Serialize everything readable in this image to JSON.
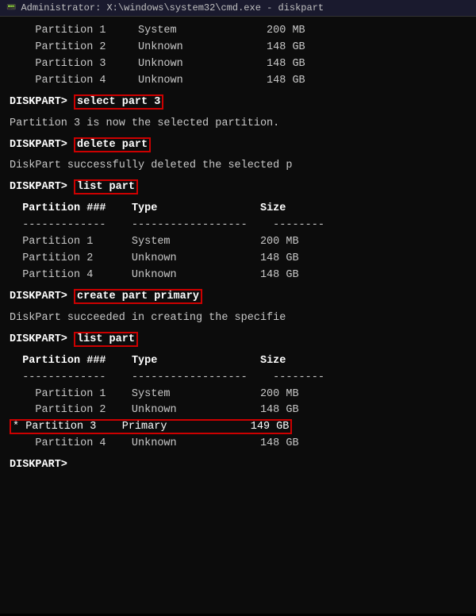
{
  "titleBar": {
    "icon": "C:\\",
    "title": "Administrator: X:\\windows\\system32\\cmd.exe - diskpart"
  },
  "terminal": {
    "initialPartitions": [
      {
        "name": "Partition 1",
        "type": "System",
        "size": "200 MB"
      },
      {
        "name": "Partition 2",
        "type": "Unknown",
        "size": "148 GB"
      },
      {
        "name": "Partition 3",
        "type": "Unknown",
        "size": "148 GB"
      },
      {
        "name": "Partition 4",
        "type": "Unknown",
        "size": "148 GB"
      }
    ],
    "cmd1": "select part 3",
    "msg1": "Partition 3 is now the selected partition.",
    "cmd2": "delete part",
    "msg2": "DiskPart successfully deleted the selected p",
    "cmd3": "list part",
    "tableHeaders": {
      "col1": "Partition ###",
      "col2": "Type",
      "col3": "Size"
    },
    "tableSep1": "-------------",
    "tableSep2": "------------------",
    "tableSep3": "--------",
    "midPartitions": [
      {
        "star": "  ",
        "name": "Partition 1",
        "type": "System",
        "size": "200 MB"
      },
      {
        "star": "  ",
        "name": "Partition 2",
        "type": "Unknown",
        "size": "148 GB"
      },
      {
        "star": "  ",
        "name": "Partition 4",
        "type": "Unknown",
        "size": "148 GB"
      }
    ],
    "cmd4": "create part primary",
    "msg4": "DiskPart succeeded in creating the specifie",
    "cmd5": "list part",
    "finalPartitions": [
      {
        "star": "  ",
        "name": "Partition 1",
        "type": "System",
        "size": "200 MB",
        "highlight": false
      },
      {
        "star": "  ",
        "name": "Partition 2",
        "type": "Unknown",
        "size": "148 GB",
        "highlight": false
      },
      {
        "star": "* ",
        "name": "Partition 3",
        "type": "Primary",
        "size": "149 GB",
        "highlight": true
      },
      {
        "star": "  ",
        "name": "Partition 4",
        "type": "Unknown",
        "size": "148 GB",
        "highlight": false
      }
    ],
    "prompt": "DISKPART> "
  }
}
